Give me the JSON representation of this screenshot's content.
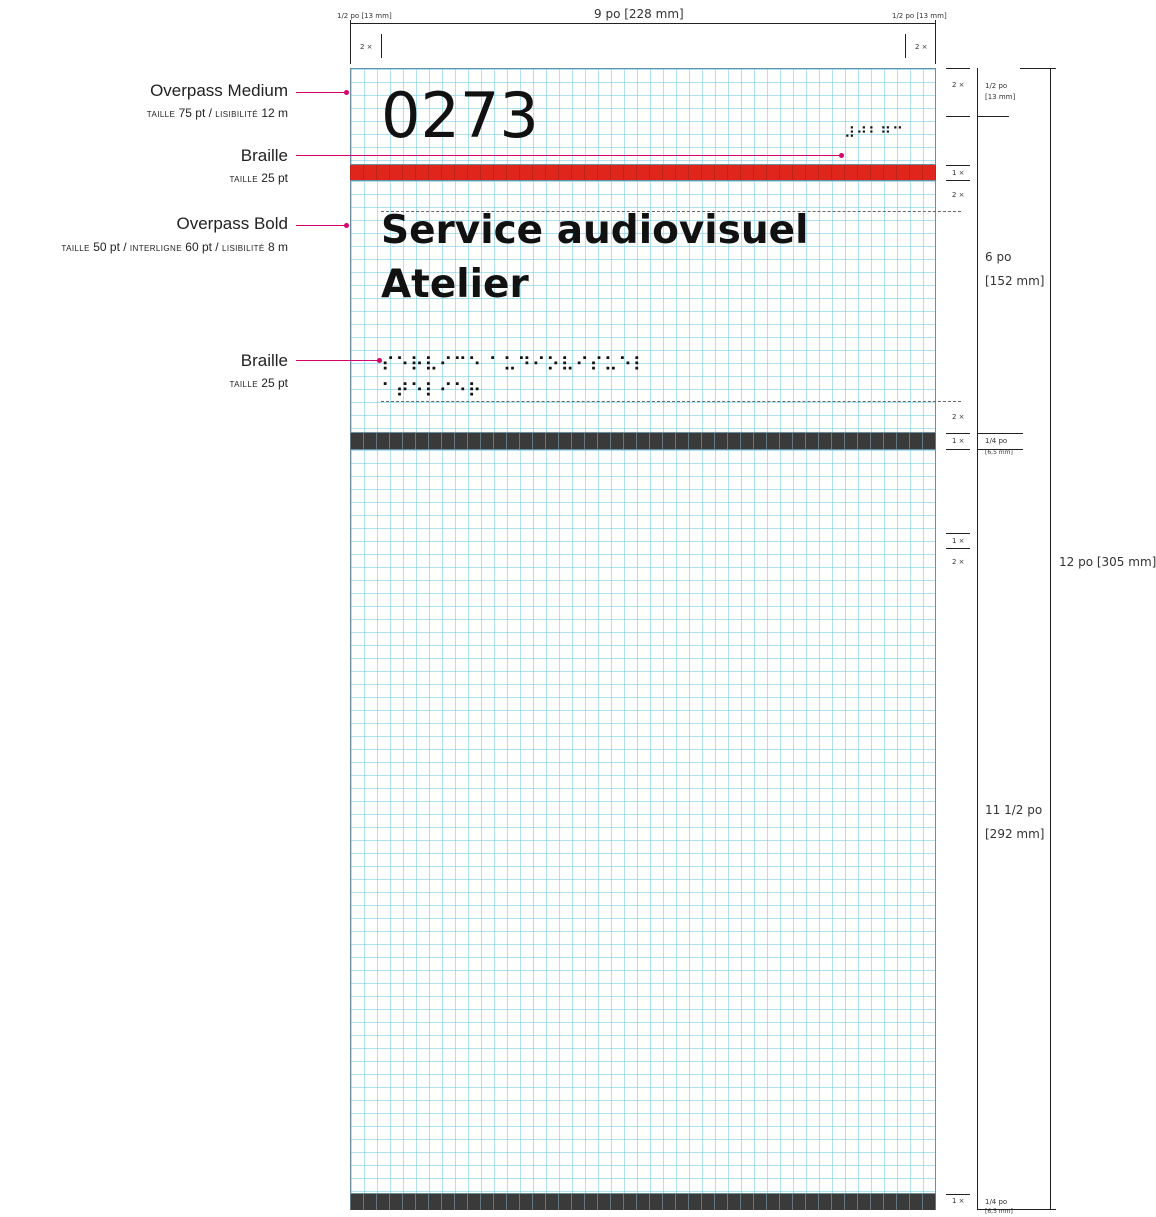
{
  "top_dims": {
    "left_margin": "1/2 po [13 mm]",
    "width": "9 po [228 mm]",
    "right_margin": "1/2 po [13 mm]",
    "left_unit": "2 ×",
    "right_unit": "2 ×"
  },
  "sign": {
    "room_number": "0273",
    "title_line1": "Service audiovisuel",
    "title_line2": "Atelier",
    "braille_number": "⠼⠚⠃⠛⠉",
    "braille_line1": "⠎⠑⠗⠧⠊⠉⠑ ⠁⠥⠙⠊⠕⠧⠊⠎⠥⠑⠇",
    "braille_line2": "⠁⠞⠑⠇⠊⠑⠗"
  },
  "labels": {
    "overpass_medium": {
      "title": "Overpass Medium",
      "sub_caps1": "taille",
      "sub_val1": " 75 pt / ",
      "sub_caps2": "lisibilité",
      "sub_val2": " 12 m"
    },
    "braille_top": {
      "title": "Braille",
      "sub_caps1": "taille",
      "sub_val1": " 25 pt"
    },
    "overpass_bold": {
      "title": "Overpass Bold",
      "sub_caps1": "taille",
      "sub_val1": " 50 pt / ",
      "sub_caps2": "interligne",
      "sub_val2": " 60 pt / ",
      "sub_caps3": "lisibilité",
      "sub_val3": " 8 m"
    },
    "braille_bottom": {
      "title": "Braille",
      "sub_caps1": "taille",
      "sub_val1": " 25 pt"
    }
  },
  "right_units": {
    "u1": "2 ×",
    "u2": "1 ×",
    "u3": "2 ×",
    "u4": "2 ×",
    "u5": "1 ×",
    "u6": "1 ×",
    "u7": "2 ×",
    "u8": "1 ×"
  },
  "right_dims": {
    "d_half_1": "1/2 po",
    "d_half_2": "[13 mm]",
    "d_six_1": "6 po",
    "d_six_2": "[152 mm]",
    "d_quarter_top_1": "1/4 po",
    "d_quarter_top_2": "[6,5 mm]",
    "d_eleven_1": "11 1/2 po",
    "d_eleven_2": "[292 mm]",
    "d_quarter_bot_1": "1/4 po",
    "d_quarter_bot_2": "[6,5 mm]",
    "d_total": "12 po [305 mm]"
  },
  "colors": {
    "accent_red": "#e0261c",
    "band_dark": "#3a3a3a",
    "grid": "#6ec8e6",
    "leader": "#d6006e"
  }
}
